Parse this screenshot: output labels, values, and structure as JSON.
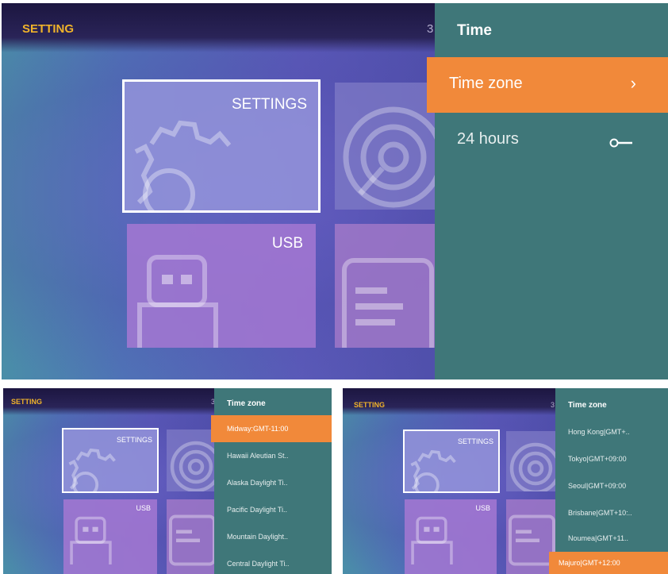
{
  "colors": {
    "accent_orange": "#f1893a",
    "title_yellow": "#f0b32a",
    "panel_teal": "#3f7779"
  },
  "main": {
    "app_title": "SETTING",
    "clock_digit": "3",
    "tiles": {
      "settings_label": "SETTINGS",
      "usb_label": "USB"
    },
    "panel": {
      "title": "Time",
      "time_zone_label": "Time zone",
      "chevron": "›",
      "hours_label": "24 hours",
      "hours_enabled": false
    }
  },
  "small_a": {
    "app_title": "SETTING",
    "clock_digit": "3",
    "tiles": {
      "settings_label": "SETTINGS",
      "usb_label": "USB"
    },
    "panel_title": "Time zone",
    "zones": [
      {
        "label": "Midway:GMT-11:00",
        "selected": true
      },
      {
        "label": "Hawaii Aleutian St..",
        "selected": false
      },
      {
        "label": "Alaska Daylight Ti..",
        "selected": false
      },
      {
        "label": "Pacific Daylight Ti..",
        "selected": false
      },
      {
        "label": "Mountain Daylight..",
        "selected": false
      },
      {
        "label": "Central Daylight Ti..",
        "selected": false
      }
    ]
  },
  "small_b": {
    "app_title": "SETTING",
    "clock_digit": "3",
    "tiles": {
      "settings_label": "SETTINGS",
      "usb_label": "USB"
    },
    "panel_title": "Time zone",
    "zones": [
      {
        "label": "Hong Kong|GMT+..",
        "selected": false
      },
      {
        "label": "Tokyo|GMT+09:00",
        "selected": false
      },
      {
        "label": "Seoul|GMT+09:00",
        "selected": false
      },
      {
        "label": "Brisbane|GMT+10:..",
        "selected": false
      },
      {
        "label": "Noumea|GMT+11..",
        "selected": false
      },
      {
        "label": "Majuro|GMT+12:00",
        "selected": true
      }
    ]
  }
}
